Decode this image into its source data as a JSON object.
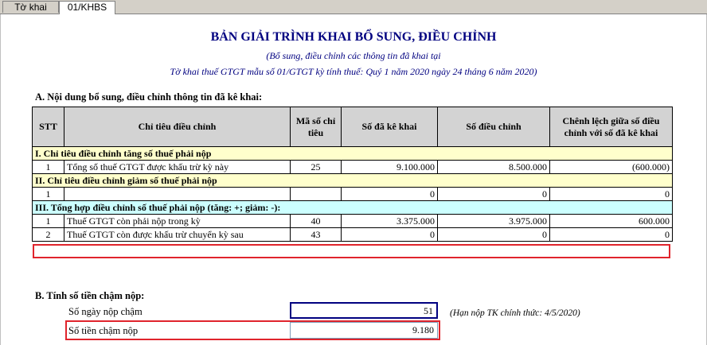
{
  "tabs": [
    {
      "label": "Tờ khai"
    },
    {
      "label": "01/KHBS"
    }
  ],
  "header": {
    "title": "BẢN GIẢI TRÌNH KHAI BỔ SUNG, ĐIỀU CHỈNH",
    "subtitle1": "(Bổ sung, điều chỉnh các thông tin đã khai tại",
    "subtitle2": "Tờ khai thuế GTGT mẫu số 01/GTGT kỳ tính thuế: Quý 1 năm 2020 ngày 24 tháng 6 năm 2020)"
  },
  "sectionA": {
    "title": "A. Nội dung bổ sung, điều chỉnh thông tin đã kê khai:",
    "columns": [
      "STT",
      "Chỉ tiêu điều chỉnh",
      "Mã số chỉ tiêu",
      "Số đã kê khai",
      "Số điều chỉnh",
      "Chênh lệch giữa số điều chỉnh với số đã kê khai"
    ],
    "group1": {
      "title": "I. Chỉ tiêu điều chỉnh tăng số thuế phải nộp",
      "rows": [
        {
          "stt": "1",
          "name": "Tổng số thuế GTGT  được khấu trừ kỳ này",
          "code": "25",
          "declared": "9.100.000",
          "adjusted": "8.500.000",
          "diff": "(600.000)"
        }
      ]
    },
    "group2": {
      "title": "II. Chỉ tiêu điều chỉnh giảm số thuế phải nộp",
      "rows": [
        {
          "stt": "1",
          "name": "",
          "code": "",
          "declared": "0",
          "adjusted": "0",
          "diff": "0"
        }
      ]
    },
    "group3": {
      "title": "III. Tổng hợp điều chỉnh số thuế phải nộp (tăng: +; giảm: -):",
      "rows": [
        {
          "stt": "1",
          "name": "Thuế GTGT còn phải nộp trong kỳ",
          "code": "40",
          "declared": "3.375.000",
          "adjusted": "3.975.000",
          "diff": "600.000"
        },
        {
          "stt": "2",
          "name": "Thuế GTGT còn được khấu trừ chuyển kỳ sau",
          "code": "43",
          "declared": "0",
          "adjusted": "0",
          "diff": "0"
        }
      ]
    }
  },
  "sectionB": {
    "title": "B. Tính số tiền chậm nộp:",
    "days_label": "Số ngày nộp chậm",
    "days_value": "51",
    "deadline_note": "(Hạn nộp TK chính thức: 4/5/2020)",
    "amount_label": "Số tiền chậm nộp",
    "amount_value": "9.180"
  },
  "colors": {
    "highlight": "#e0242c",
    "title_blue": "#000080",
    "section_yellow": "#ffffcc",
    "section_cyan": "#ccffff",
    "header_gray": "#d3d3d3"
  }
}
